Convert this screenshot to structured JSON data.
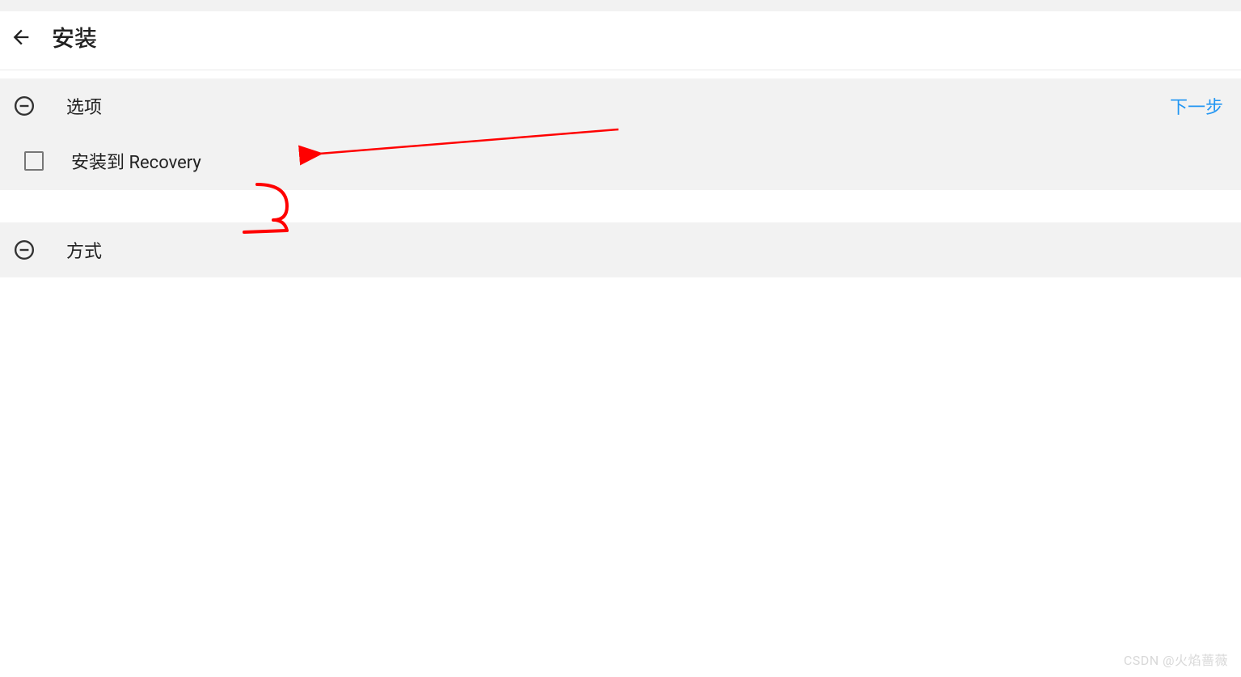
{
  "header": {
    "title": "安装"
  },
  "sections": {
    "options": {
      "title": "选项",
      "next_label": "下一步",
      "checkbox_label": "安装到 Recovery"
    },
    "mode": {
      "title": "方式"
    }
  },
  "annotation": {
    "number": "3"
  },
  "watermark": "CSDN @火焰蔷薇"
}
